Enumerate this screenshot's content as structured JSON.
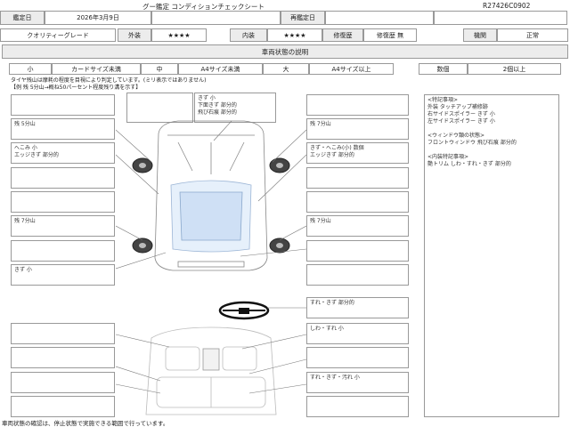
{
  "sheet": {
    "title": "グー鑑定 コンディションチェックシート",
    "code": "R27426C0902",
    "inspection_date_label": "鑑定日",
    "inspection_date": "2026年3月9日",
    "reinspection_date_label": "再鑑定日",
    "reinspection_date": ""
  },
  "grades": {
    "quality_label": "クオリティーグレード",
    "exterior_label": "外装",
    "exterior_stars": "★★★★",
    "interior_label": "内装",
    "interior_stars": "★★★★",
    "repair_label": "修復歴",
    "repair_value": "修復歴 無",
    "engine_label": "機関",
    "engine_value": "正常"
  },
  "section_title": "車両状態の説明",
  "legend": {
    "small": "小",
    "small_desc": "カードサイズ未満",
    "medium": "中",
    "medium_desc": "A4サイズ未満",
    "large": "大",
    "large_desc": "A4サイズ以上",
    "count_label": "数個",
    "count_desc": "2個以上"
  },
  "tire_note_1": "タイヤ残山は摩耗の程度を目視により判定しています。(ミリ表示ではありません)",
  "tire_note_2": "【例 残 5分山→概ね50パーセント程度残り溝を示す】",
  "labels": {
    "front_center": "きず 小\n下面きず 部分的\n飛び石痕 部分的",
    "left_1": "残 5分山",
    "right_1": "残 7分山",
    "left_2": "へこみ 小\nエッジきず 部分的",
    "right_2": "きず・へこみ(小) 数個\nエッジきず 部分的",
    "left_3": "残 7分山",
    "right_3": "残 7分山",
    "left_4": "きず 小",
    "steering": "すれ・きず 部分的",
    "interior_1": "しわ・すれ 小",
    "interior_2": "すれ・きず・汚れ 小"
  },
  "special_notes": "<特記事項>\n外装 タッチアップ補修跡\n右サイドスポイラー きず 小\n左サイドスポイラー きず 小\n\n<ウィンドウ類の状態>\nフロントウィンドウ 飛び石痕 部分的\n\n<内装特記事項>\n艶トリム しわ・すれ・きず 部分的",
  "footer": "車両状態の確認は、停止状態で実施できる範囲で行っています。"
}
